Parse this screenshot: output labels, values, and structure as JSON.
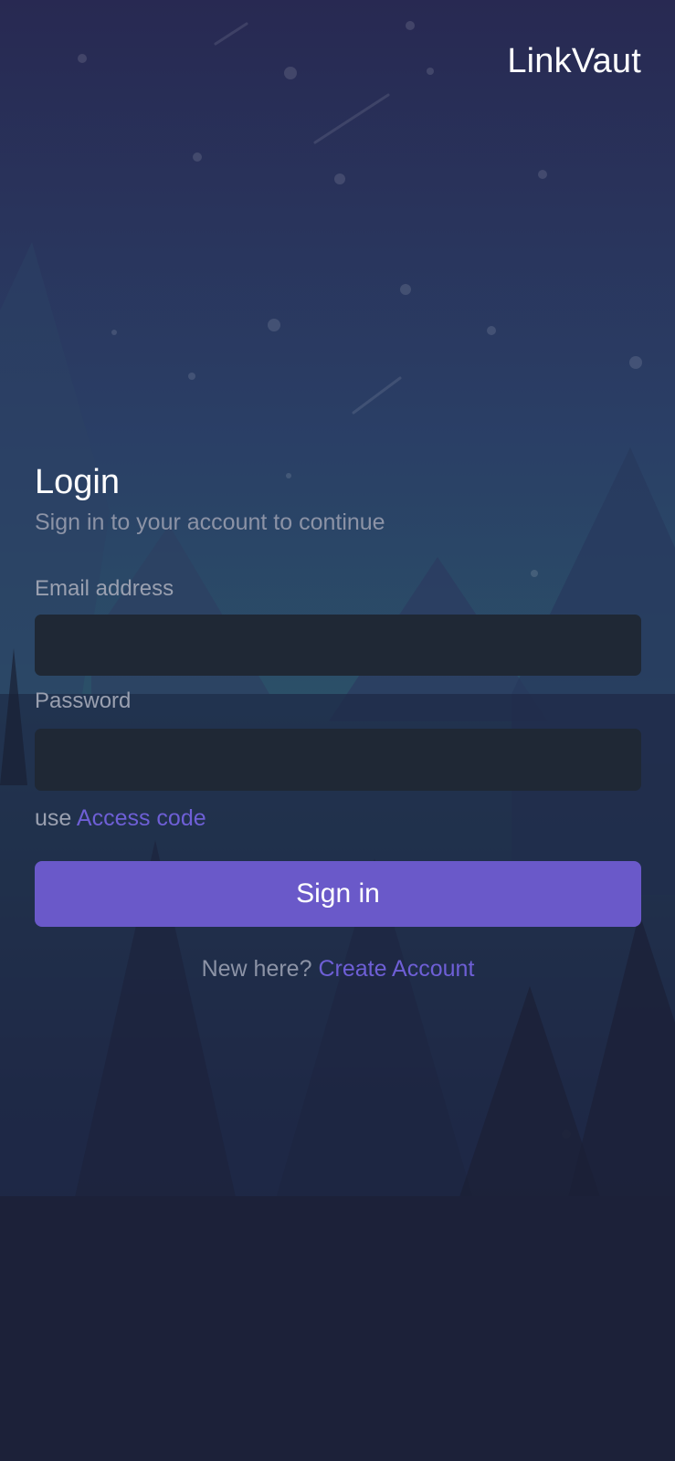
{
  "brand": {
    "name": "LinkVaut"
  },
  "login": {
    "title": "Login",
    "subtitle": "Sign in to your account to continue",
    "email_label": "Email address",
    "email_value": "",
    "password_label": "Password",
    "password_value": "",
    "access_prefix": "use",
    "access_link": "Access code",
    "signin_label": "Sign in",
    "new_here": "New here?",
    "create_account": "Create Account"
  },
  "colors": {
    "accent": "#6a59c9",
    "link": "#6e5fd6",
    "field_bg": "#1f2835",
    "background_top": "#272b55",
    "background_bottom": "#1c2139"
  }
}
